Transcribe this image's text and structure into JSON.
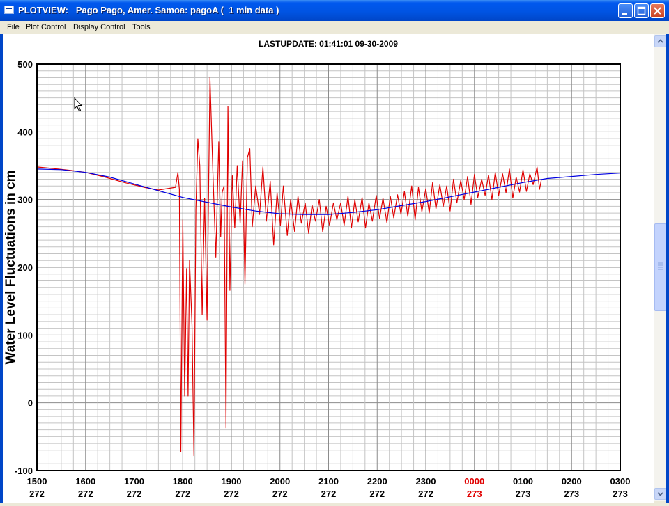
{
  "window": {
    "title": "PLOTVIEW:   Pago Pago, Amer. Samoa: pagoA (  1 min data )",
    "buttons": [
      "minimize",
      "maximize",
      "close"
    ]
  },
  "menu": [
    "File",
    "Plot Control",
    "Display Control",
    "Tools"
  ],
  "header": {
    "lastupdate": "LASTUPDATE: 01:41:01  09-30-2009"
  },
  "chart_data": {
    "type": "line",
    "title": "LASTUPDATE: 01:41:01  09-30-2009",
    "ylabel": "Water Level Fluctuations in cm",
    "xlabel": "",
    "ylim": [
      -100,
      500
    ],
    "yticks": [
      500,
      400,
      300,
      200,
      100,
      0,
      -100
    ],
    "xticks": [
      {
        "time": "1500",
        "day": "272"
      },
      {
        "time": "1600",
        "day": "272"
      },
      {
        "time": "1700",
        "day": "272"
      },
      {
        "time": "1800",
        "day": "272"
      },
      {
        "time": "1900",
        "day": "272"
      },
      {
        "time": "2000",
        "day": "272"
      },
      {
        "time": "2100",
        "day": "272"
      },
      {
        "time": "2200",
        "day": "272"
      },
      {
        "time": "2300",
        "day": "272"
      },
      {
        "time": "0000",
        "day": "273",
        "highlight": true
      },
      {
        "time": "0100",
        "day": "273"
      },
      {
        "time": "0200",
        "day": "273"
      },
      {
        "time": "0300",
        "day": "273"
      }
    ],
    "xlim_hours": [
      0,
      12
    ],
    "grid": true,
    "highlight_color": "#E00000",
    "series": [
      {
        "color": "#E00000",
        "points": [
          [
            0.0,
            348
          ],
          [
            0.3,
            346
          ],
          [
            0.7,
            343
          ],
          [
            1.0,
            340
          ],
          [
            1.4,
            333
          ],
          [
            1.8,
            325
          ],
          [
            2.2,
            318
          ],
          [
            2.5,
            314
          ],
          [
            2.85,
            318
          ],
          [
            2.9,
            340
          ],
          [
            2.93,
            315
          ],
          [
            2.96,
            -72
          ],
          [
            3.0,
            270
          ],
          [
            3.04,
            10
          ],
          [
            3.08,
            198
          ],
          [
            3.11,
            10
          ],
          [
            3.14,
            210
          ],
          [
            3.19,
            115
          ],
          [
            3.23,
            -78
          ],
          [
            3.27,
            285
          ],
          [
            3.31,
            390
          ],
          [
            3.35,
            350
          ],
          [
            3.4,
            130
          ],
          [
            3.45,
            302
          ],
          [
            3.5,
            122
          ],
          [
            3.56,
            480
          ],
          [
            3.62,
            340
          ],
          [
            3.68,
            215
          ],
          [
            3.74,
            385
          ],
          [
            3.78,
            245
          ],
          [
            3.81,
            310
          ],
          [
            3.85,
            320
          ],
          [
            3.89,
            -37
          ],
          [
            3.93,
            437
          ],
          [
            3.97,
            166
          ],
          [
            4.02,
            335
          ],
          [
            4.07,
            258
          ],
          [
            4.12,
            350
          ],
          [
            4.18,
            265
          ],
          [
            4.23,
            357
          ],
          [
            4.28,
            175
          ],
          [
            4.33,
            362
          ],
          [
            4.38,
            375
          ],
          [
            4.43,
            260
          ],
          [
            4.5,
            320
          ],
          [
            4.58,
            278
          ],
          [
            4.65,
            348
          ],
          [
            4.72,
            268
          ],
          [
            4.8,
            327
          ],
          [
            4.87,
            233
          ],
          [
            4.94,
            310
          ],
          [
            5.01,
            262
          ],
          [
            5.07,
            320
          ],
          [
            5.15,
            247
          ],
          [
            5.22,
            300
          ],
          [
            5.3,
            253
          ],
          [
            5.37,
            305
          ],
          [
            5.44,
            265
          ],
          [
            5.52,
            295
          ],
          [
            5.59,
            250
          ],
          [
            5.66,
            292
          ],
          [
            5.73,
            268
          ],
          [
            5.81,
            300
          ],
          [
            5.88,
            252
          ],
          [
            5.95,
            290
          ],
          [
            6.02,
            262
          ],
          [
            6.1,
            295
          ],
          [
            6.17,
            270
          ],
          [
            6.25,
            295
          ],
          [
            6.32,
            262
          ],
          [
            6.4,
            305
          ],
          [
            6.47,
            258
          ],
          [
            6.54,
            300
          ],
          [
            6.61,
            267
          ],
          [
            6.69,
            303
          ],
          [
            6.76,
            258
          ],
          [
            6.83,
            295
          ],
          [
            6.9,
            268
          ],
          [
            6.98,
            306
          ],
          [
            7.05,
            272
          ],
          [
            7.12,
            302
          ],
          [
            7.2,
            266
          ],
          [
            7.27,
            305
          ],
          [
            7.34,
            273
          ],
          [
            7.42,
            307
          ],
          [
            7.49,
            278
          ],
          [
            7.56,
            312
          ],
          [
            7.63,
            275
          ],
          [
            7.71,
            320
          ],
          [
            7.78,
            270
          ],
          [
            7.85,
            318
          ],
          [
            7.92,
            282
          ],
          [
            8.0,
            316
          ],
          [
            8.07,
            280
          ],
          [
            8.14,
            325
          ],
          [
            8.21,
            286
          ],
          [
            8.29,
            322
          ],
          [
            8.36,
            290
          ],
          [
            8.43,
            320
          ],
          [
            8.5,
            283
          ],
          [
            8.57,
            330
          ],
          [
            8.64,
            295
          ],
          [
            8.72,
            328
          ],
          [
            8.79,
            300
          ],
          [
            8.86,
            334
          ],
          [
            8.93,
            293
          ],
          [
            9.0,
            337
          ],
          [
            9.07,
            303
          ],
          [
            9.15,
            330
          ],
          [
            9.22,
            306
          ],
          [
            9.29,
            336
          ],
          [
            9.36,
            300
          ],
          [
            9.43,
            340
          ],
          [
            9.5,
            306
          ],
          [
            9.58,
            338
          ],
          [
            9.65,
            310
          ],
          [
            9.72,
            345
          ],
          [
            9.79,
            302
          ],
          [
            9.86,
            333
          ],
          [
            9.93,
            311
          ],
          [
            10.0,
            344
          ],
          [
            10.07,
            312
          ],
          [
            10.14,
            338
          ],
          [
            10.21,
            322
          ],
          [
            10.29,
            348
          ],
          [
            10.34,
            315
          ],
          [
            10.38,
            330
          ]
        ]
      },
      {
        "color": "#0000E0",
        "points": [
          [
            0.0,
            345
          ],
          [
            0.5,
            344
          ],
          [
            1.0,
            340
          ],
          [
            1.5,
            333
          ],
          [
            2.0,
            323
          ],
          [
            2.5,
            313
          ],
          [
            3.0,
            303
          ],
          [
            3.5,
            296
          ],
          [
            4.0,
            289
          ],
          [
            4.5,
            283
          ],
          [
            5.0,
            279
          ],
          [
            5.5,
            278
          ],
          [
            6.0,
            278
          ],
          [
            6.5,
            281
          ],
          [
            7.0,
            285
          ],
          [
            7.5,
            291
          ],
          [
            8.0,
            297
          ],
          [
            8.5,
            304
          ],
          [
            9.0,
            311
          ],
          [
            9.5,
            318
          ],
          [
            10.0,
            325
          ],
          [
            10.5,
            331
          ],
          [
            11.0,
            334
          ],
          [
            11.5,
            337
          ],
          [
            12.0,
            339
          ]
        ]
      }
    ]
  }
}
